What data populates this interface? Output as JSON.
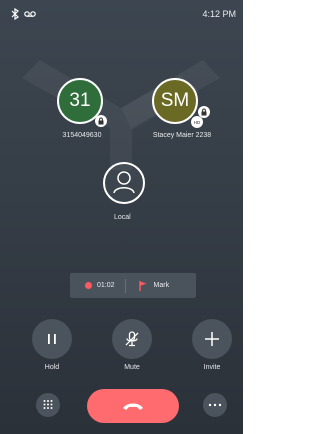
{
  "status_bar": {
    "time": "4:12 PM",
    "icons": [
      "bluetooth-icon",
      "voicemail-icon"
    ]
  },
  "participants": [
    {
      "initials": "31",
      "name": "3154049630",
      "color": "#2f6d3b",
      "badges": [
        "lock-icon"
      ]
    },
    {
      "initials": "SM",
      "name": "Stacey Maier 2238",
      "color": "#6b6a25",
      "badges": [
        "lock-icon",
        "hd-icon"
      ]
    }
  ],
  "local": {
    "label": "Local",
    "icon": "person-icon"
  },
  "recording": {
    "time": "01:02",
    "mark_label": "Mark",
    "accent": "#ff5a5f"
  },
  "controls": [
    {
      "label": "Hold",
      "icon": "pause-icon"
    },
    {
      "label": "Mute",
      "icon": "mic-muted-icon"
    },
    {
      "label": "Invite",
      "icon": "plus-icon"
    }
  ],
  "bottom_bar": {
    "left_icon": "dialpad-icon",
    "center_icon": "end-call-icon",
    "right_icon": "more-icon",
    "end_call_color": "#ff6b6f"
  }
}
